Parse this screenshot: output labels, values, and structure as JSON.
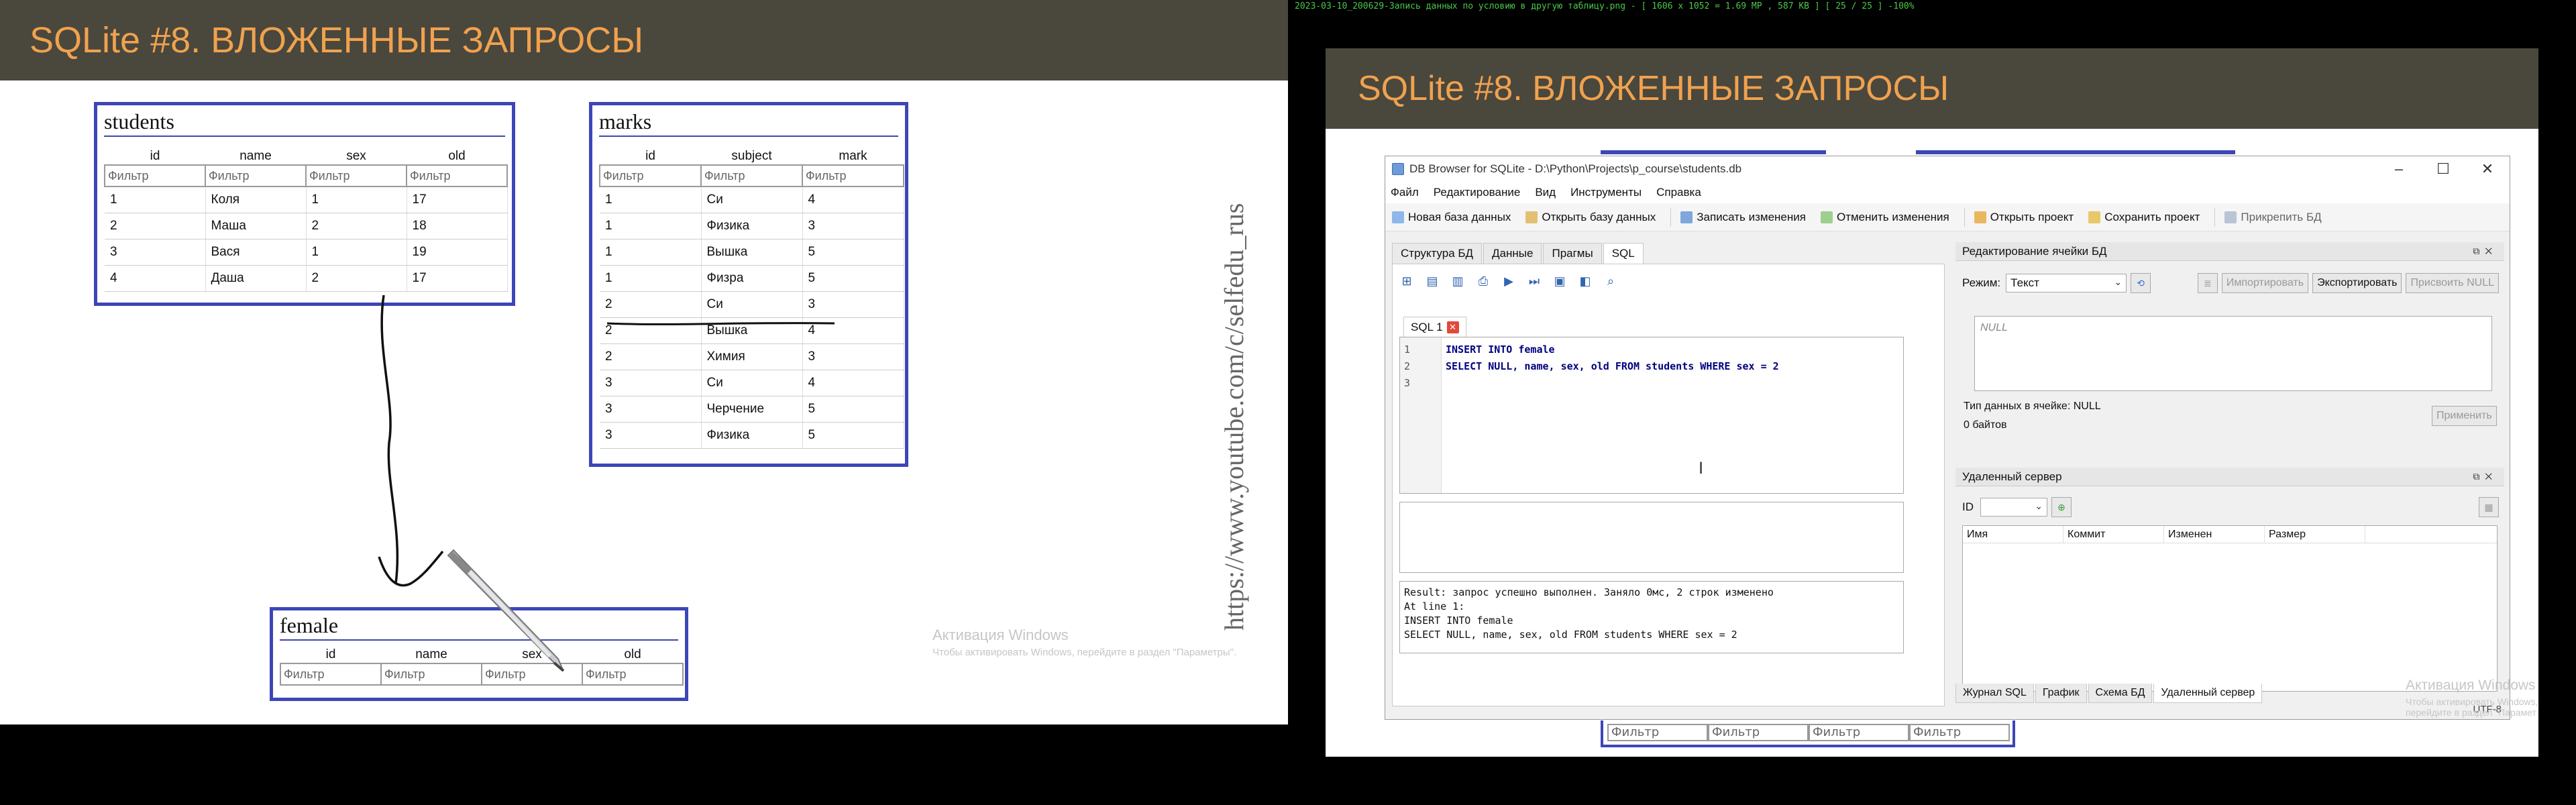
{
  "left_slide": {
    "title": "SQLite #8. ВЛОЖЕННЫЕ ЗАПРОСЫ",
    "filter_placeholder": "Фильтр",
    "students": {
      "name": "students",
      "columns": [
        "id",
        "name",
        "sex",
        "old"
      ],
      "rows": [
        [
          "1",
          "Коля",
          "1",
          "17"
        ],
        [
          "2",
          "Маша",
          "2",
          "18"
        ],
        [
          "3",
          "Вася",
          "1",
          "19"
        ],
        [
          "4",
          "Даша",
          "2",
          "17"
        ]
      ]
    },
    "marks": {
      "name": "marks",
      "columns": [
        "id",
        "subject",
        "mark"
      ],
      "rows": [
        [
          "1",
          "Си",
          "4"
        ],
        [
          "1",
          "Физика",
          "3"
        ],
        [
          "1",
          "Вышка",
          "5"
        ],
        [
          "1",
          "Физра",
          "5"
        ],
        [
          "2",
          "Си",
          "3"
        ],
        [
          "2",
          "Вышка",
          "4"
        ],
        [
          "2",
          "Химия",
          "3"
        ],
        [
          "3",
          "Си",
          "4"
        ],
        [
          "3",
          "Черчение",
          "5"
        ],
        [
          "3",
          "Физика",
          "5"
        ]
      ]
    },
    "female": {
      "name": "female",
      "columns": [
        "id",
        "name",
        "sex",
        "old"
      ]
    },
    "youtube_watermark": "https://www.youtube.com/c/selfedu_rus",
    "activation_title": "Активация Windows",
    "activation_text": "Чтобы активировать Windows, перейдите в раздел \"Параметры\"."
  },
  "video_info": "2023-03-10_200629-Запись данных по условию в другую таблицу.png - [ 1606 x 1052 = 1.69 MP ,  587 KB ]  [ 25 / 25 ]  -100%",
  "right_slide": {
    "title": "SQLite #8. ВЛОЖЕННЫЕ ЗАПРОСЫ",
    "female_filters": [
      "Фильтр",
      "Фильтр",
      "Фильтр",
      "Фильтр"
    ],
    "activation_title": "Активация Windows",
    "activation_text": "Чтобы активировать Windows, перейдите в раздел \"Парамет"
  },
  "dbb": {
    "window_title": "DB Browser for SQLite - D:\\Python\\Projects\\p_course\\students.db",
    "menu": [
      "Файл",
      "Редактирование",
      "Вид",
      "Инструменты",
      "Справка"
    ],
    "toolbar": {
      "new_db": "Новая база данных",
      "open_db": "Открыть базу данных",
      "write_changes": "Записать изменения",
      "revert_changes": "Отменить изменения",
      "open_project": "Открыть проект",
      "save_project": "Сохранить проект",
      "attach_db": "Прикрепить БД"
    },
    "main_tabs": [
      "Структура БД",
      "Данные",
      "Прагмы",
      "SQL"
    ],
    "sql_tab_label": "SQL 1",
    "editor_line_numbers": [
      "1",
      "2",
      "3"
    ],
    "editor_lines": [
      "INSERT INTO female",
      "SELECT NULL, name, sex, old FROM students WHERE sex = 2",
      ""
    ],
    "message_text": "Result: запрос успешно выполнен. Заняло 0мс, 2 строк изменено\nAt line 1:\nINSERT INTO female\nSELECT NULL, name, sex, old FROM students WHERE sex = 2",
    "edit_cell": {
      "title": "Редактирование ячейки БД",
      "mode_label": "Режим:",
      "mode_value": "Текст",
      "import_label": "Импортировать",
      "export_label": "Экспортировать",
      "set_null_label": "Присвоить NULL",
      "null_text": "NULL",
      "type_text": "Тип данных в ячейке: NULL",
      "size_text": "0 байтов",
      "apply_label": "Применить"
    },
    "remote": {
      "title": "Удаленный сервер",
      "id_label": "ID",
      "columns": [
        "Имя",
        "Коммит",
        "Изменен",
        "Размер"
      ]
    },
    "bottom_tabs": [
      "Журнал SQL",
      "График",
      "Схема БД",
      "Удаленный сервер"
    ],
    "encoding": "UTF-8"
  },
  "colors": {
    "title_bar": "#4a473d",
    "title_text": "#f0a24e",
    "table_border": "#3d46b6"
  }
}
